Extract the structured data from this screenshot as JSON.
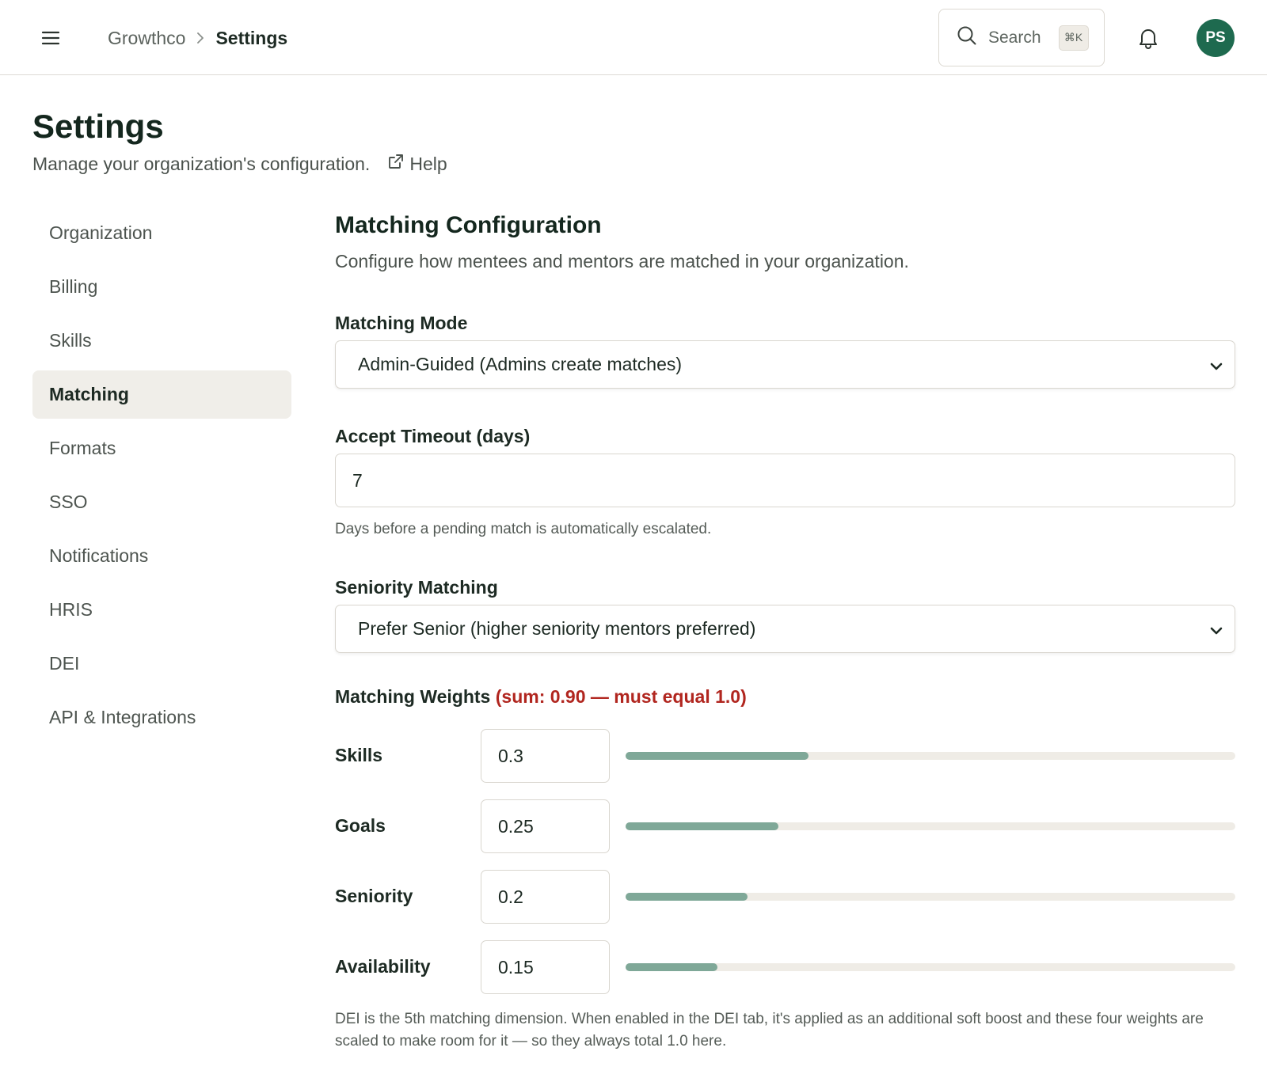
{
  "header": {
    "breadcrumb_org": "Growthco",
    "breadcrumb_current": "Settings",
    "search_label": "Search",
    "search_shortcut": "⌘K",
    "avatar_initials": "PS"
  },
  "page": {
    "title": "Settings",
    "subtitle": "Manage your organization's configuration.",
    "help_label": "Help"
  },
  "sidebar": {
    "items": [
      {
        "label": "Organization"
      },
      {
        "label": "Billing"
      },
      {
        "label": "Skills"
      },
      {
        "label": "Matching"
      },
      {
        "label": "Formats"
      },
      {
        "label": "SSO"
      },
      {
        "label": "Notifications"
      },
      {
        "label": "HRIS"
      },
      {
        "label": "DEI"
      },
      {
        "label": "API & Integrations"
      }
    ],
    "active": "Matching"
  },
  "main": {
    "title": "Matching Configuration",
    "subtitle": "Configure how mentees and mentors are matched in your organization.",
    "matching_mode": {
      "label": "Matching Mode",
      "value": "Admin-Guided (Admins create matches)"
    },
    "accept_timeout": {
      "label": "Accept Timeout (days)",
      "value": "7",
      "hint": "Days before a pending match is automatically escalated."
    },
    "seniority": {
      "label": "Seniority Matching",
      "value": "Prefer Senior (higher seniority mentors preferred)"
    },
    "weights": {
      "title": "Matching Weights",
      "warning": "(sum: 0.90 — must equal 1.0)",
      "rows": [
        {
          "label": "Skills",
          "value": "0.3",
          "level": 0.3
        },
        {
          "label": "Goals",
          "value": "0.25",
          "level": 0.25
        },
        {
          "label": "Seniority",
          "value": "0.2",
          "level": 0.2
        },
        {
          "label": "Availability",
          "value": "0.15",
          "level": 0.15
        }
      ]
    },
    "footer_note": "DEI is the 5th matching dimension. When enabled in the DEI tab, it's applied as an additional soft boost and these four weights are scaled to make room for it — so they always total 1.0 here."
  },
  "colors": {
    "accent": "#1e6a4f",
    "slider_fill": "#7fa898",
    "warning": "#b1261f"
  }
}
